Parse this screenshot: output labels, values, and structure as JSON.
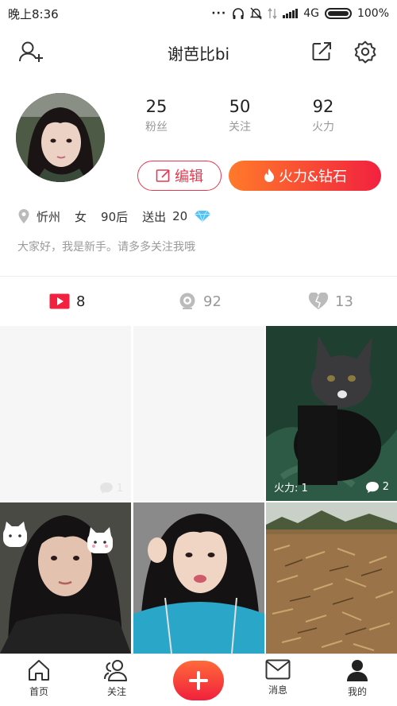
{
  "status_bar": {
    "time": "晚上8:36",
    "network": "4G",
    "battery": "100%"
  },
  "header": {
    "title": "谢芭比bi",
    "icons": [
      "add-friend-icon",
      "share-icon",
      "settings-icon"
    ]
  },
  "profile": {
    "stats": [
      {
        "value": "25",
        "label": "粉丝"
      },
      {
        "value": "50",
        "label": "关注"
      },
      {
        "value": "92",
        "label": "火力"
      }
    ],
    "edit_label": "编辑",
    "fire_label": "火力&钻石",
    "location": "忻州",
    "gender": "女",
    "age_group": "90后",
    "sent_label": "送出",
    "sent_count": "20",
    "bio": "大家好，我是新手。请多多关注我哦"
  },
  "tabs": [
    {
      "icon": "video-icon",
      "count": "8"
    },
    {
      "icon": "live-icon",
      "count": "92"
    },
    {
      "icon": "heart-icon",
      "count": "13"
    }
  ],
  "grid": {
    "cells": [
      {
        "fire": "",
        "comments": "1"
      },
      {
        "fire": "",
        "comments": ""
      },
      {
        "fire": "火力: 1",
        "comments": "2"
      },
      {
        "fire": "",
        "comments": ""
      },
      {
        "fire": "",
        "comments": ""
      },
      {
        "fire": "",
        "comments": ""
      }
    ]
  },
  "bottom_nav": {
    "items": [
      {
        "label": "首页",
        "icon": "home-icon"
      },
      {
        "label": "关注",
        "icon": "follow-icon"
      },
      {
        "label": "",
        "icon": "plus-icon"
      },
      {
        "label": "消息",
        "icon": "message-icon"
      },
      {
        "label": "我的",
        "icon": "profile-icon"
      }
    ]
  },
  "colors": {
    "accent": "#f2213f",
    "accent_orange": "#ff7a2a",
    "diamond": "#4fc3f7"
  }
}
